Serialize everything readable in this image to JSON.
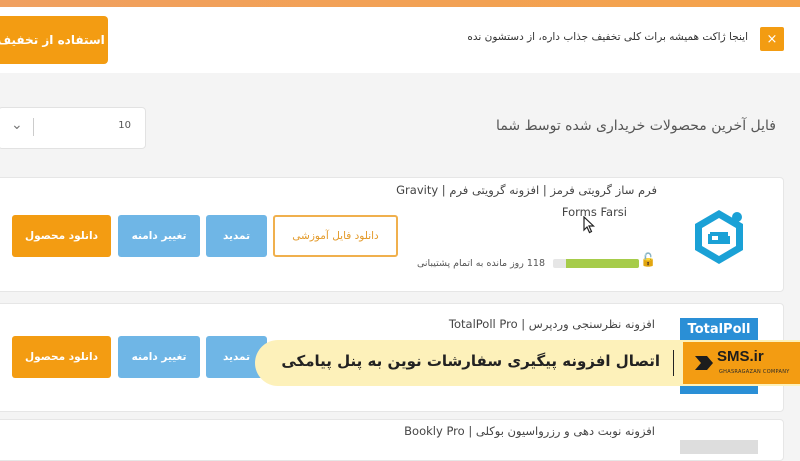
{
  "notice": {
    "button_label": "استفاده از تخفیف",
    "text": "اینجا ژاکت همیشه برات کلی تخفیف جذاب داره، از دستشون نده",
    "close_glyph": "×"
  },
  "section": {
    "title": "فایل آخرین محصولات خریداری شده توسط شما",
    "per_page_value": "10"
  },
  "products": [
    {
      "title_line1": "فرم ساز گرویتی فرمز | افزونه گرویتی فرم | Gravity",
      "title_line2": "Forms Farsi",
      "support_text": "118 روز مانده به اتمام پشتیبانی",
      "support_fraction": 0.85,
      "buttons": {
        "tutorial": "دانلود فایل آموزشی",
        "renew": "تمدید",
        "change_domain": "تغییر دامنه",
        "download": "دانلود محصول"
      }
    },
    {
      "title_line1": "افزونه نظرسنجی وردپرس | TotalPoll Pro",
      "logo_text": "TotalPoll",
      "buttons": {
        "renew": "تمدید",
        "change_domain": "تغییر دامنه",
        "download": "دانلود محصول"
      }
    },
    {
      "title_line1": "افزونه نوبت دهی و رزرواسیون بوکلی | Bookly Pro"
    }
  ],
  "overlay": {
    "caption": "اتصال افزونه پیگیری سفارشات نوین به پنل پیامکی",
    "brand": "SMS.ir",
    "brand_sub": "GHASRAGAZAN COMPANY"
  },
  "colors": {
    "accent": "#f39c12",
    "blue_button": "#6fb6e6",
    "progress": "#a6cc4a",
    "overlay_bg": "#fdf1ba"
  }
}
